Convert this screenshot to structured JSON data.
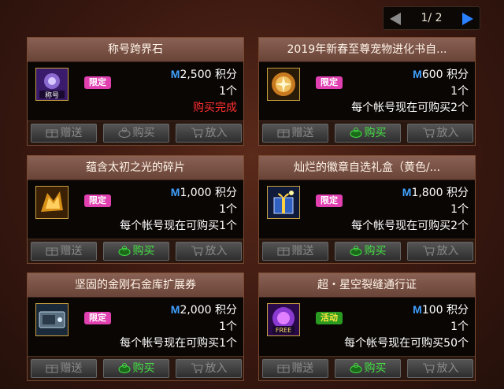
{
  "pager": {
    "current": "1",
    "total": "2",
    "text": "1/ 2"
  },
  "labels": {
    "gift": "赠送",
    "buy": "购买",
    "cart": "放入",
    "currency_unit": "积分",
    "currency_symbol": "M"
  },
  "colors": {
    "limited_badge": "#e040b0",
    "event_badge": "#2a9a20",
    "buy_enabled": "#44e044",
    "done_text": "#ff3030"
  },
  "items": [
    {
      "title": "称号跨界石",
      "badge": "限定",
      "badge_type": "limited",
      "price": "2,500",
      "qty": "1个",
      "note": "购买完成",
      "note_type": "done",
      "buy_enabled": false,
      "icon": "title-stone-icon"
    },
    {
      "title": "2019年新春至尊宠物进化书自...",
      "badge": "限定",
      "badge_type": "limited",
      "price": "600",
      "qty": "1个",
      "note": "每个帐号现在可购买2个",
      "note_type": "normal",
      "buy_enabled": true,
      "icon": "pet-evolution-book-icon"
    },
    {
      "title": "蕴含太初之光的碎片",
      "badge": "限定",
      "badge_type": "limited",
      "price": "1,000",
      "qty": "1个",
      "note": "每个帐号现在可购买1个",
      "note_type": "normal",
      "buy_enabled": true,
      "icon": "light-fragment-icon"
    },
    {
      "title": "灿烂的徽章自选礼盒（黄色/...",
      "badge": "限定",
      "badge_type": "limited",
      "price": "1,800",
      "qty": "1个",
      "note": "每个帐号现在可购买2个",
      "note_type": "normal",
      "buy_enabled": true,
      "icon": "emblem-gift-box-icon"
    },
    {
      "title": "坚固的金刚石金库扩展券",
      "badge": "限定",
      "badge_type": "limited",
      "price": "2,000",
      "qty": "1个",
      "note": "每个帐号现在可购买1个",
      "note_type": "normal",
      "buy_enabled": true,
      "icon": "vault-expansion-ticket-icon"
    },
    {
      "title": "超・星空裂缝通行证",
      "badge": "活动",
      "badge_type": "event",
      "price": "100",
      "qty": "1个",
      "note": "每个帐号现在可购买50个",
      "note_type": "normal",
      "buy_enabled": true,
      "icon": "starry-rift-pass-icon"
    }
  ],
  "icon_captions": {
    "title_stone": "称号",
    "free_pass": "FREE"
  }
}
